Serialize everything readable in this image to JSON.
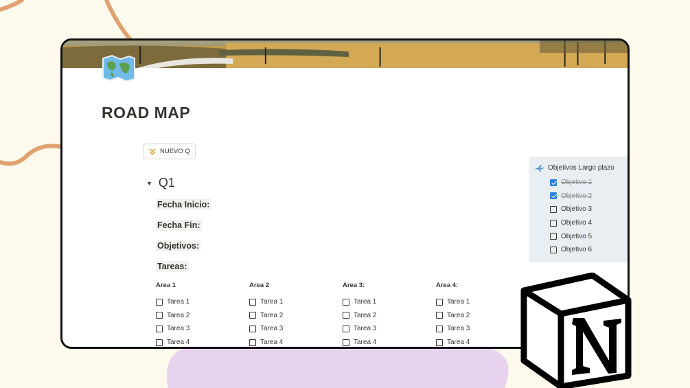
{
  "page": {
    "title": "ROAD MAP",
    "icon": "world-map-icon",
    "cover": "prairie-road-cover"
  },
  "toolbar": {
    "new_q_label": "NUEVO Q",
    "new_q_icon": "double-chevron-down-icon"
  },
  "toggle": {
    "title": "Q1",
    "arrow": "▼"
  },
  "fields": {
    "start": "Fecha Inicio:",
    "end": "Fecha Fin:",
    "objectives": "Objetivos:",
    "tasks": "Tareas:"
  },
  "areas": [
    {
      "title": "Area 1",
      "tasks": [
        "Tarea 1",
        "Tarea 2",
        "Tarea 3",
        "Tarea 4"
      ]
    },
    {
      "title": "Area 2",
      "tasks": [
        "Tarea 1",
        "Tarea 2",
        "Tarea 3",
        "Tarea 4"
      ]
    },
    {
      "title": "Area 3:",
      "tasks": [
        "Tarea 1",
        "Tarea 2",
        "Tarea 3",
        "Tarea 4"
      ]
    },
    {
      "title": "Area 4:",
      "tasks": [
        "Tarea 1",
        "Tarea 2",
        "Tarea 3",
        "Tarea 4"
      ]
    }
  ],
  "callout": {
    "title": "Objetivos Largo plazo",
    "icon": "airplane-icon",
    "items": [
      {
        "label": "Objetivo 1",
        "checked": true
      },
      {
        "label": "Objetivo 2",
        "checked": true
      },
      {
        "label": "Objetivo 3",
        "checked": false
      },
      {
        "label": "Objetivo 4",
        "checked": false
      },
      {
        "label": "Objetivo 5",
        "checked": false
      },
      {
        "label": "Objetivo 6",
        "checked": false
      }
    ]
  },
  "colors": {
    "background": "#fdf9ec",
    "accent_orange": "#e0a16e",
    "accent_lilac": "#e7d3ee",
    "callout_bg": "#e8eef2",
    "checkbox_checked": "#2f80e0"
  },
  "brand": {
    "logo": "notion-logo"
  }
}
